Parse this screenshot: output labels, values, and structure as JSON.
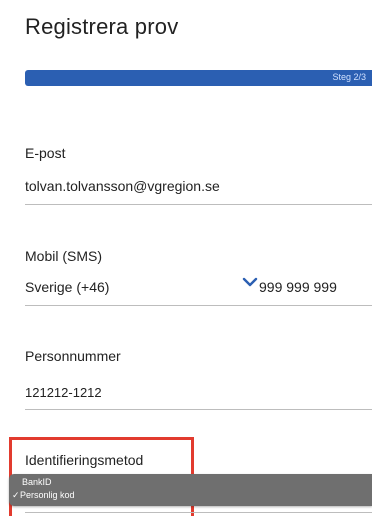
{
  "page": {
    "title": "Registrera prov"
  },
  "progress": {
    "step_label": "Steg 2/3",
    "current_step": 2,
    "total_steps": 3,
    "bar_color": "#2b5fb2"
  },
  "email": {
    "label": "E-post",
    "value": "tolvan.tolvansson@vgregion.se"
  },
  "mobile": {
    "label": "Mobil (SMS)",
    "country": "Sverige (+46)",
    "number": "999 999 999",
    "chevron_icon": "chevron-down-icon"
  },
  "personnummer": {
    "label": "Personnummer",
    "value": "121212-1212"
  },
  "identification": {
    "label": "Identifieringsmetod",
    "options": [
      {
        "label": "BankID",
        "selected": false
      },
      {
        "label": "Personlig kod",
        "selected": true
      }
    ],
    "check_mark": "✓",
    "highlight_color": "#e23b2e"
  }
}
